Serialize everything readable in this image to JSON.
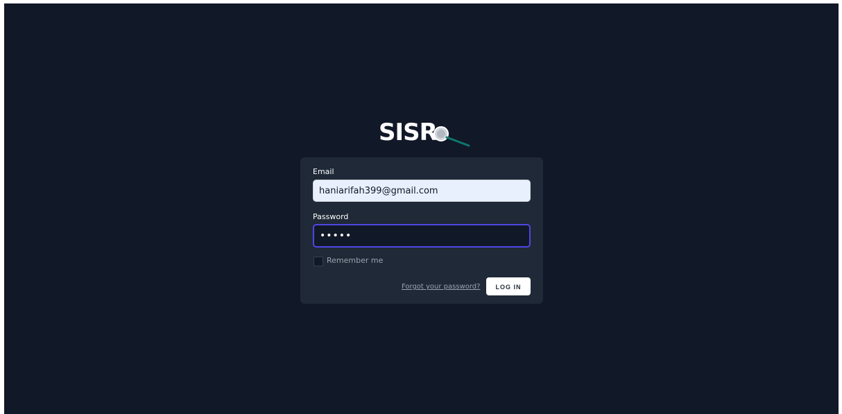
{
  "logo": {
    "text": "SISR"
  },
  "form": {
    "email_label": "Email",
    "email_value": "haniarifah399@gmail.com",
    "password_label": "Password",
    "password_value": "•••••",
    "remember_label": "Remember me",
    "remember_checked": false,
    "forgot_link": "Forgot your password?",
    "login_button": "LOG IN"
  },
  "colors": {
    "background": "#111827",
    "card": "#1f2937",
    "focus_ring": "#4f46e5",
    "input_autofill": "#e8f0fe",
    "button": "#ffffff"
  }
}
